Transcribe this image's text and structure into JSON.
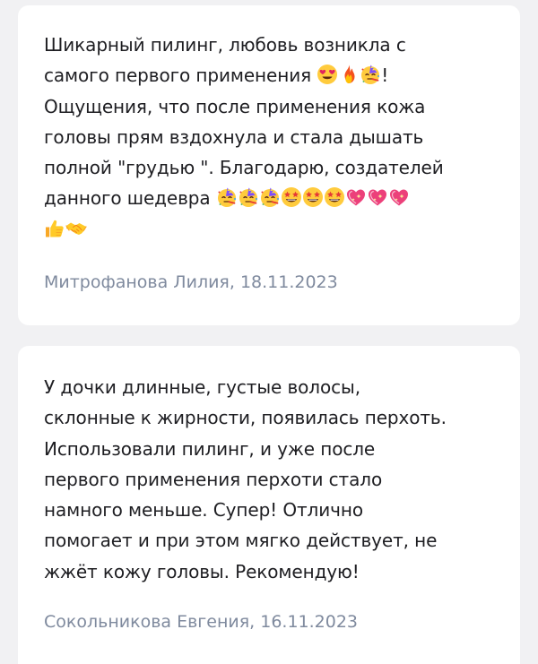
{
  "reviews": [
    {
      "lines": [
        "Шикарный пилинг, любовь возникла с",
        "самого первого применения",
        "Ощущения, что после применения кожа",
        "головы прям вздохнула и стала дышать",
        "полной \"грудью \". Благодарю, создателей",
        "данного шедевра"
      ],
      "line2_suffix": "!",
      "line2_emojis": [
        "heart-eyes-emoji",
        "fire-emoji",
        "party-face-emoji"
      ],
      "line6_emojis": [
        "party-face-emoji",
        "party-face-emoji",
        "party-face-emoji",
        "star-struck-emoji",
        "star-struck-emoji",
        "star-struck-emoji",
        "sparkling-heart-emoji",
        "sparkling-heart-emoji",
        "sparkling-heart-emoji"
      ],
      "line7_emojis": [
        "thumbs-up-emoji",
        "handshake-emoji"
      ],
      "author": "Митрофанова Лилия, 18.11.2023"
    },
    {
      "lines": [
        "У дочки длинные, густые волосы,",
        "склонные к жирности, появилась перхоть.",
        "Использовали пилинг, и уже после",
        "первого применения перхоти стало",
        "намного меньше. Супер! Отлично",
        "помогает и при этом мягко действует, не",
        "жжёт кожу головы. Рекомендую!"
      ],
      "author": "Сокольникова Евгения, 16.11.2023"
    }
  ],
  "colors": {
    "background": "#f1f1f3",
    "card": "#ffffff",
    "text": "#1e1e22",
    "author": "#7f8a9e"
  }
}
